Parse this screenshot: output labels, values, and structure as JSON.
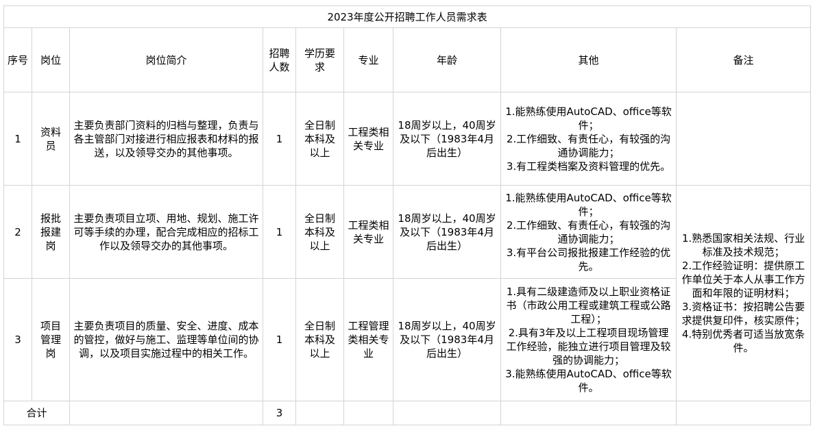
{
  "title": "2023年度公开招聘工作人员需求表",
  "headers": {
    "seq": "序号",
    "position": "岗位",
    "intro": "岗位简介",
    "count": "招聘人数",
    "education": "学历要求",
    "major": "专业",
    "age": "年龄",
    "other": "其他",
    "remark": "备注"
  },
  "rows": [
    {
      "seq": "1",
      "position": "资料员",
      "intro": "主要负责部门资料的归档与整理，负责与各主管部门对接进行相应报表和材料的报送，以及领导交办的其他事项。",
      "count": "1",
      "education": "全日制本科及以上",
      "major": "工程类相关专业",
      "age": "18周岁以上，40周岁及以下（1983年4月后出生）",
      "other": "1.能熟练使用AutoCAD、office等软件；\n2.工作细致、有责任心，有较强的沟通协调能力；\n3.有工程类档案及资料管理的优先。"
    },
    {
      "seq": "2",
      "position": "报批报建岗",
      "intro": "主要负责项目立项、用地、规划、施工许可等手续的办理，配合完成相应的招标工作以及领导交办的其他事项。",
      "count": "1",
      "education": "全日制本科及以上",
      "major": "工程类相关专业",
      "age": "18周岁以上，40周岁及以下（1983年4月后出生）",
      "other": "1.能熟练使用AutoCAD、office等软件；\n2.工作细致、有责任心，有较强的沟通协调能力；\n3.有平台公司报批报建工作经验的优先。"
    },
    {
      "seq": "3",
      "position": "项目管理岗",
      "intro": "主要负责项目的质量、安全、进度、成本的管控，做好与施工、监理等单位间的协调，以及项目实施过程中的相关工作。",
      "count": "1",
      "education": "全日制本科及以上",
      "major": "工程管理类相关专业",
      "age": "18周岁以上，40周岁及以下（1983年4月后出生）",
      "other": "1.具有二级建造师及以上职业资格证书（市政公用工程或建筑工程或公路工程）；\n2.具有3年及以上工程项目现场管理工作经验，能独立进行项目管理及较强的协调能力；\n3.能熟练使用AutoCAD、office等软件。"
    }
  ],
  "remark": "1.熟悉国家相关法规、行业标准及技术规范；\n2.工作经验证明：提供原工作单位关于本人从事工作方面和年限的证明材料；\n3.资格证书：按招聘公告要求提供复印件，核实原件；\n4.特别优秀者可适当放宽条件。",
  "total": {
    "label": "合计",
    "count": "3"
  }
}
